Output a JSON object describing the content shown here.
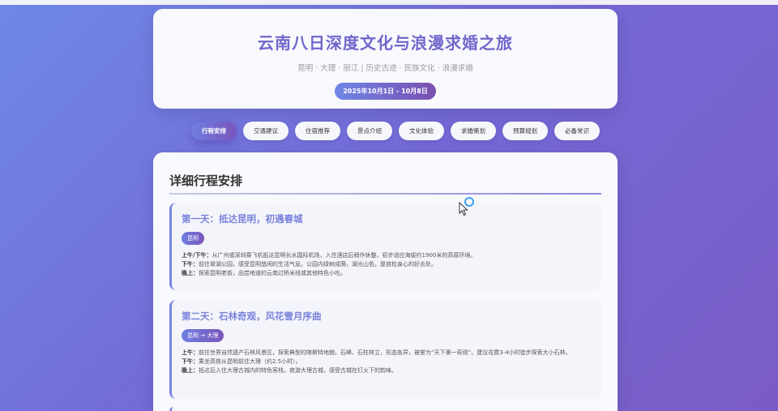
{
  "header": {
    "title": "云南八日深度文化与浪漫求婚之旅",
    "subtitle": "昆明 · 大理 · 丽江 | 历史古迹 · 民族文化 · 浪漫求婚",
    "date": "2025年10月1日 - 10月8日"
  },
  "nav": [
    "行程安排",
    "交通建议",
    "住宿推荐",
    "景点介绍",
    "文化体验",
    "求婚策划",
    "预算规划",
    "必备常识"
  ],
  "section": {
    "title": "详细行程安排"
  },
  "days": [
    {
      "title": "第一天：抵达昆明，初遇春城",
      "tag": "昆明",
      "items": [
        {
          "label": "上午/下午：",
          "text": "从广州或深圳乘飞机抵达昆明长水国际机场，入住酒店后稍作休整，初步适应海拔约1900米的高原环境。"
        },
        {
          "label": "下午：",
          "text": "前往翠湖公园，感受昆明悠闲的生活气息。公园内绿树成荫，湖光山色，是放松身心的好去处。"
        },
        {
          "label": "晚上：",
          "text": "探索昆明老街，品尝地道的云南过桥米线或其他特色小吃。"
        }
      ]
    },
    {
      "title": "第二天：石林奇观，风花雪月序曲",
      "tag": "昆明 → 大理",
      "items": [
        {
          "label": "上午：",
          "text": "前往世界自然遗产石林风景区，探索典型的喀斯特地貌。石峰、石柱林立，形态各异，被誉为“天下第一奇观”。建议花费3-4小时徒步探索大小石林。"
        },
        {
          "label": "下午：",
          "text": "乘坐高铁从昆明前往大理（约2.5小时）。"
        },
        {
          "label": "晚上：",
          "text": "抵达后入住大理古城内的特色客栈，夜游大理古城，感受古城在灯火下的韵味。"
        }
      ]
    }
  ]
}
